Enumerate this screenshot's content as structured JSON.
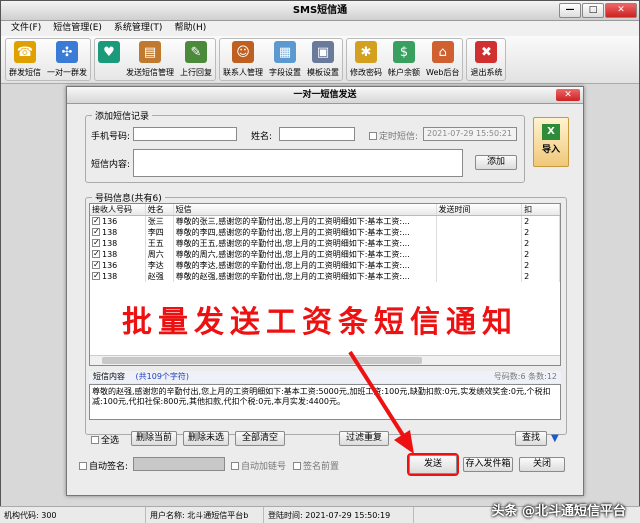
{
  "app": {
    "title": "SMS短信通",
    "minimize": "—",
    "maximize": "□",
    "close": "✕"
  },
  "menu": [
    "文件(F)",
    "短信管理(E)",
    "系统管理(T)",
    "帮助(H)"
  ],
  "toolbar": {
    "group1": [
      {
        "label": "群发短信",
        "icon": "phone-icon",
        "color": "#e0a000"
      },
      {
        "label": "一对一群发",
        "icon": "network-icon",
        "color": "#3a7bd5"
      }
    ],
    "group2": [
      {
        "label": "",
        "icon": "heart-icon",
        "color": "#1a9a7a"
      },
      {
        "label": "发送短信管理",
        "icon": "send-manage-icon",
        "color": "#c07a30"
      },
      {
        "label": "上行回复",
        "icon": "reply-icon",
        "color": "#4a8a3a"
      }
    ],
    "group3": [
      {
        "label": "联系人管理",
        "icon": "contacts-icon",
        "color": "#c06020"
      },
      {
        "label": "字段设置",
        "icon": "fields-icon",
        "color": "#5a9ad0"
      },
      {
        "label": "模板设置",
        "icon": "template-icon",
        "color": "#6a7a9a"
      }
    ],
    "group4": [
      {
        "label": "修改密码",
        "icon": "password-icon",
        "color": "#d4a020"
      },
      {
        "label": "帐户余额",
        "icon": "balance-icon",
        "color": "#3aa060"
      },
      {
        "label": "Web后台",
        "icon": "web-icon",
        "color": "#d06030"
      }
    ],
    "group5": [
      {
        "label": "退出系统",
        "icon": "exit-icon",
        "color": "#d03030"
      }
    ]
  },
  "dialog": {
    "title": "一对一短信发送",
    "close": "✕",
    "add_section": "添加短信记录",
    "phone_label": "手机号码:",
    "phone_value": "",
    "name_label": "姓名:",
    "name_value": "",
    "scheduled_label": "定时短信:",
    "scheduled_value": "2021-07-29  15:50:21",
    "content_label": "短信内容:",
    "add_button": "添加",
    "import_button": "导入",
    "numbers_section": "号码信息(共有6)",
    "columns": [
      "接收人号码",
      "姓名",
      "短信",
      "发送时间",
      "扣"
    ],
    "rows": [
      {
        "phone": "136",
        "name": "张三",
        "sms": "尊敬的张三,感谢您的辛勤付出,您上月的工资明细如下:基本工资:...",
        "time": "",
        "count": "2"
      },
      {
        "phone": "138",
        "name": "李四",
        "sms": "尊敬的李四,感谢您的辛勤付出,您上月的工资明细如下:基本工资:...",
        "time": "",
        "count": "2"
      },
      {
        "phone": "138",
        "name": "王五",
        "sms": "尊敬的王五,感谢您的辛勤付出,您上月的工资明细如下:基本工资:...",
        "time": "",
        "count": "2"
      },
      {
        "phone": "138",
        "name": "周六",
        "sms": "尊敬的周六,感谢您的辛勤付出,您上月的工资明细如下:基本工资:...",
        "time": "",
        "count": "2"
      },
      {
        "phone": "136",
        "name": "李达",
        "sms": "尊敬的李达,感谢您的辛勤付出,您上月的工资明细如下:基本工资:...",
        "time": "",
        "count": "2"
      },
      {
        "phone": "138",
        "name": "赵强",
        "sms": "尊敬的赵强,感谢您的辛勤付出,您上月的工资明细如下:基本工资:...",
        "time": "",
        "count": "2"
      }
    ],
    "overlay_text": "批量发送工资条短信通知",
    "sms_content_label": "短信内容",
    "char_count": "(共109个字符)",
    "number_count": "号码数:6  条数:12",
    "preview_text": "尊敬的赵强,感谢您的辛勤付出,您上月的工资明细如下:基本工资:5000元,加班工资:100元,缺勤扣款:0元,实发绩效奖金:0元,个税扣减:100元,代扣社保:800元,其他扣款,代扣个税:0元,本月实发:4400元。",
    "select_all": "全选",
    "delete_current": "删除当前",
    "delete_unselected": "删除未选",
    "clear_all": "全部清空",
    "filter_dup": "过滤重复",
    "find": "查找",
    "auto_sign_label": "自动签名:",
    "auto_add_num": "自动加链号",
    "sign_prefix": "签名前置",
    "send": "发送",
    "save_outbox": "存入发件箱",
    "close_btn": "关闭"
  },
  "status": {
    "org_code": "机构代码: 300",
    "user": "用户名称: 北斗通短信平台b",
    "login_time": "登陆时间: 2021-07-29  15:50:19"
  },
  "watermark": "头条 @北斗通短信平台",
  "colors": {
    "accent_red": "#e11111",
    "selected_blue": "#3a7bd5"
  }
}
